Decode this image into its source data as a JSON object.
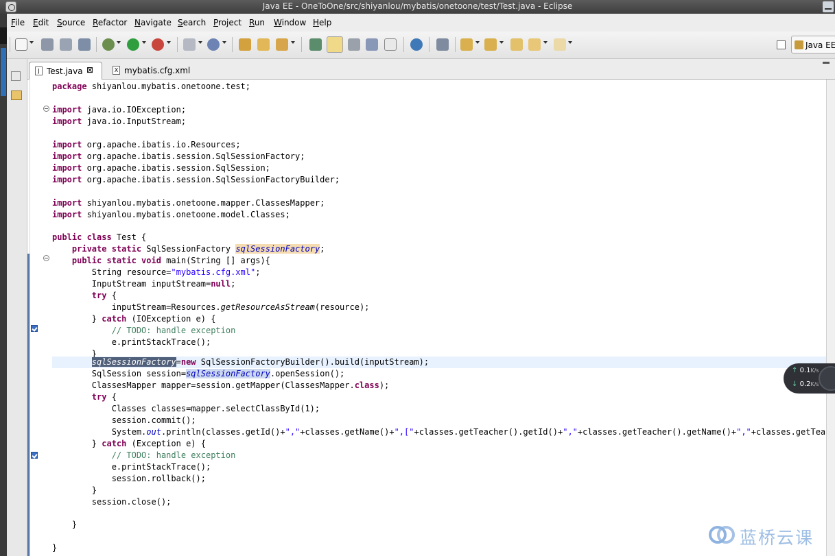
{
  "window": {
    "title": "Java EE - OneToOne/src/shiyanlou/mybatis/onetoone/test/Test.java - Eclipse"
  },
  "menu": [
    "File",
    "Edit",
    "Source",
    "Refactor",
    "Navigate",
    "Search",
    "Project",
    "Run",
    "Window",
    "Help"
  ],
  "perspective": {
    "label": "Java EE"
  },
  "tabs": [
    {
      "label": "Test.java",
      "active": true,
      "close": "⊠"
    },
    {
      "label": "mybatis.cfg.xml",
      "active": false
    }
  ],
  "code": {
    "l01": [
      "package",
      " shiyanlou.mybatis.onetoone.test;"
    ],
    "l03": [
      "import",
      " java.io.IOException;"
    ],
    "l04": [
      "import",
      " java.io.InputStream;"
    ],
    "l06": [
      "import",
      " org.apache.ibatis.io.Resources;"
    ],
    "l07": [
      "import",
      " org.apache.ibatis.session.SqlSessionFactory;"
    ],
    "l08": [
      "import",
      " org.apache.ibatis.session.SqlSession;"
    ],
    "l09": [
      "import",
      " org.apache.ibatis.session.SqlSessionFactoryBuilder;"
    ],
    "l11": [
      "import",
      " shiyanlou.mybatis.onetoone.mapper.ClassesMapper;"
    ],
    "l12": [
      "import",
      " shiyanlou.mybatis.onetoone.model.Classes;"
    ],
    "l14": [
      "public class",
      " Test {"
    ],
    "l15": [
      "    ",
      "private static",
      " SqlSessionFactory ",
      "sqlSessionFactory",
      ";"
    ],
    "l16": [
      "    ",
      "public static void",
      " main(String [] args){"
    ],
    "l17": [
      "        String resource=",
      "\"mybatis.cfg.xml\"",
      ";"
    ],
    "l18": [
      "        InputStream inputStream=",
      "null",
      ";"
    ],
    "l19": [
      "        ",
      "try",
      " {"
    ],
    "l20": [
      "            inputStream=Resources.",
      "getResourceAsStream",
      "(resource);"
    ],
    "l21": [
      "        } ",
      "catch",
      " (IOException e) {"
    ],
    "l22": [
      "            ",
      "// TODO: handle exception"
    ],
    "l23": [
      "            e.printStackTrace();"
    ],
    "l24": [
      "        }"
    ],
    "l25": [
      "        ",
      "sqlSessionFactory",
      "=",
      "new",
      " SqlSessionFactoryBuilder().build(inputStream);"
    ],
    "l26": [
      "        SqlSession session=",
      "sqlSessionFactory",
      ".openSession();"
    ],
    "l27": [
      "        ClassesMapper mapper=session.getMapper(ClassesMapper.",
      "class",
      ");"
    ],
    "l28": [
      "        ",
      "try",
      " {"
    ],
    "l29": [
      "            Classes classes=mapper.selectClassById(1);"
    ],
    "l30": [
      "            session.commit();"
    ],
    "l31": [
      "            System.",
      "out",
      ".println(classes.getId()+",
      "\",\"",
      "+classes.getName()+",
      "\",[\"",
      "+classes.getTeacher().getId()+",
      "\",\"",
      "+classes.getTeacher().getName()+",
      "\",\"",
      "+classes.getTeacher()."
    ],
    "l32": [
      "        } ",
      "catch",
      " (Exception e) {"
    ],
    "l33": [
      "            ",
      "// TODO: handle exception"
    ],
    "l34": [
      "            e.printStackTrace();"
    ],
    "l35": [
      "            session.rollback();"
    ],
    "l36": [
      "        }"
    ],
    "l37": [
      "        session.close();"
    ],
    "l39": [
      "    }"
    ],
    "l41": [
      "}"
    ]
  },
  "network": {
    "up_value": "0.1",
    "up_unit": "K/s",
    "down_value": "0.2",
    "down_unit": "K/s",
    "up_arrow": "↑",
    "down_arrow": "↓"
  },
  "watermark": {
    "text": "蓝桥云课"
  },
  "colors": {
    "keyword": "#7f0055",
    "string": "#2a00ff",
    "comment": "#3f7f5f",
    "field": "#0000c0",
    "current_line": "#e8f2fe"
  }
}
